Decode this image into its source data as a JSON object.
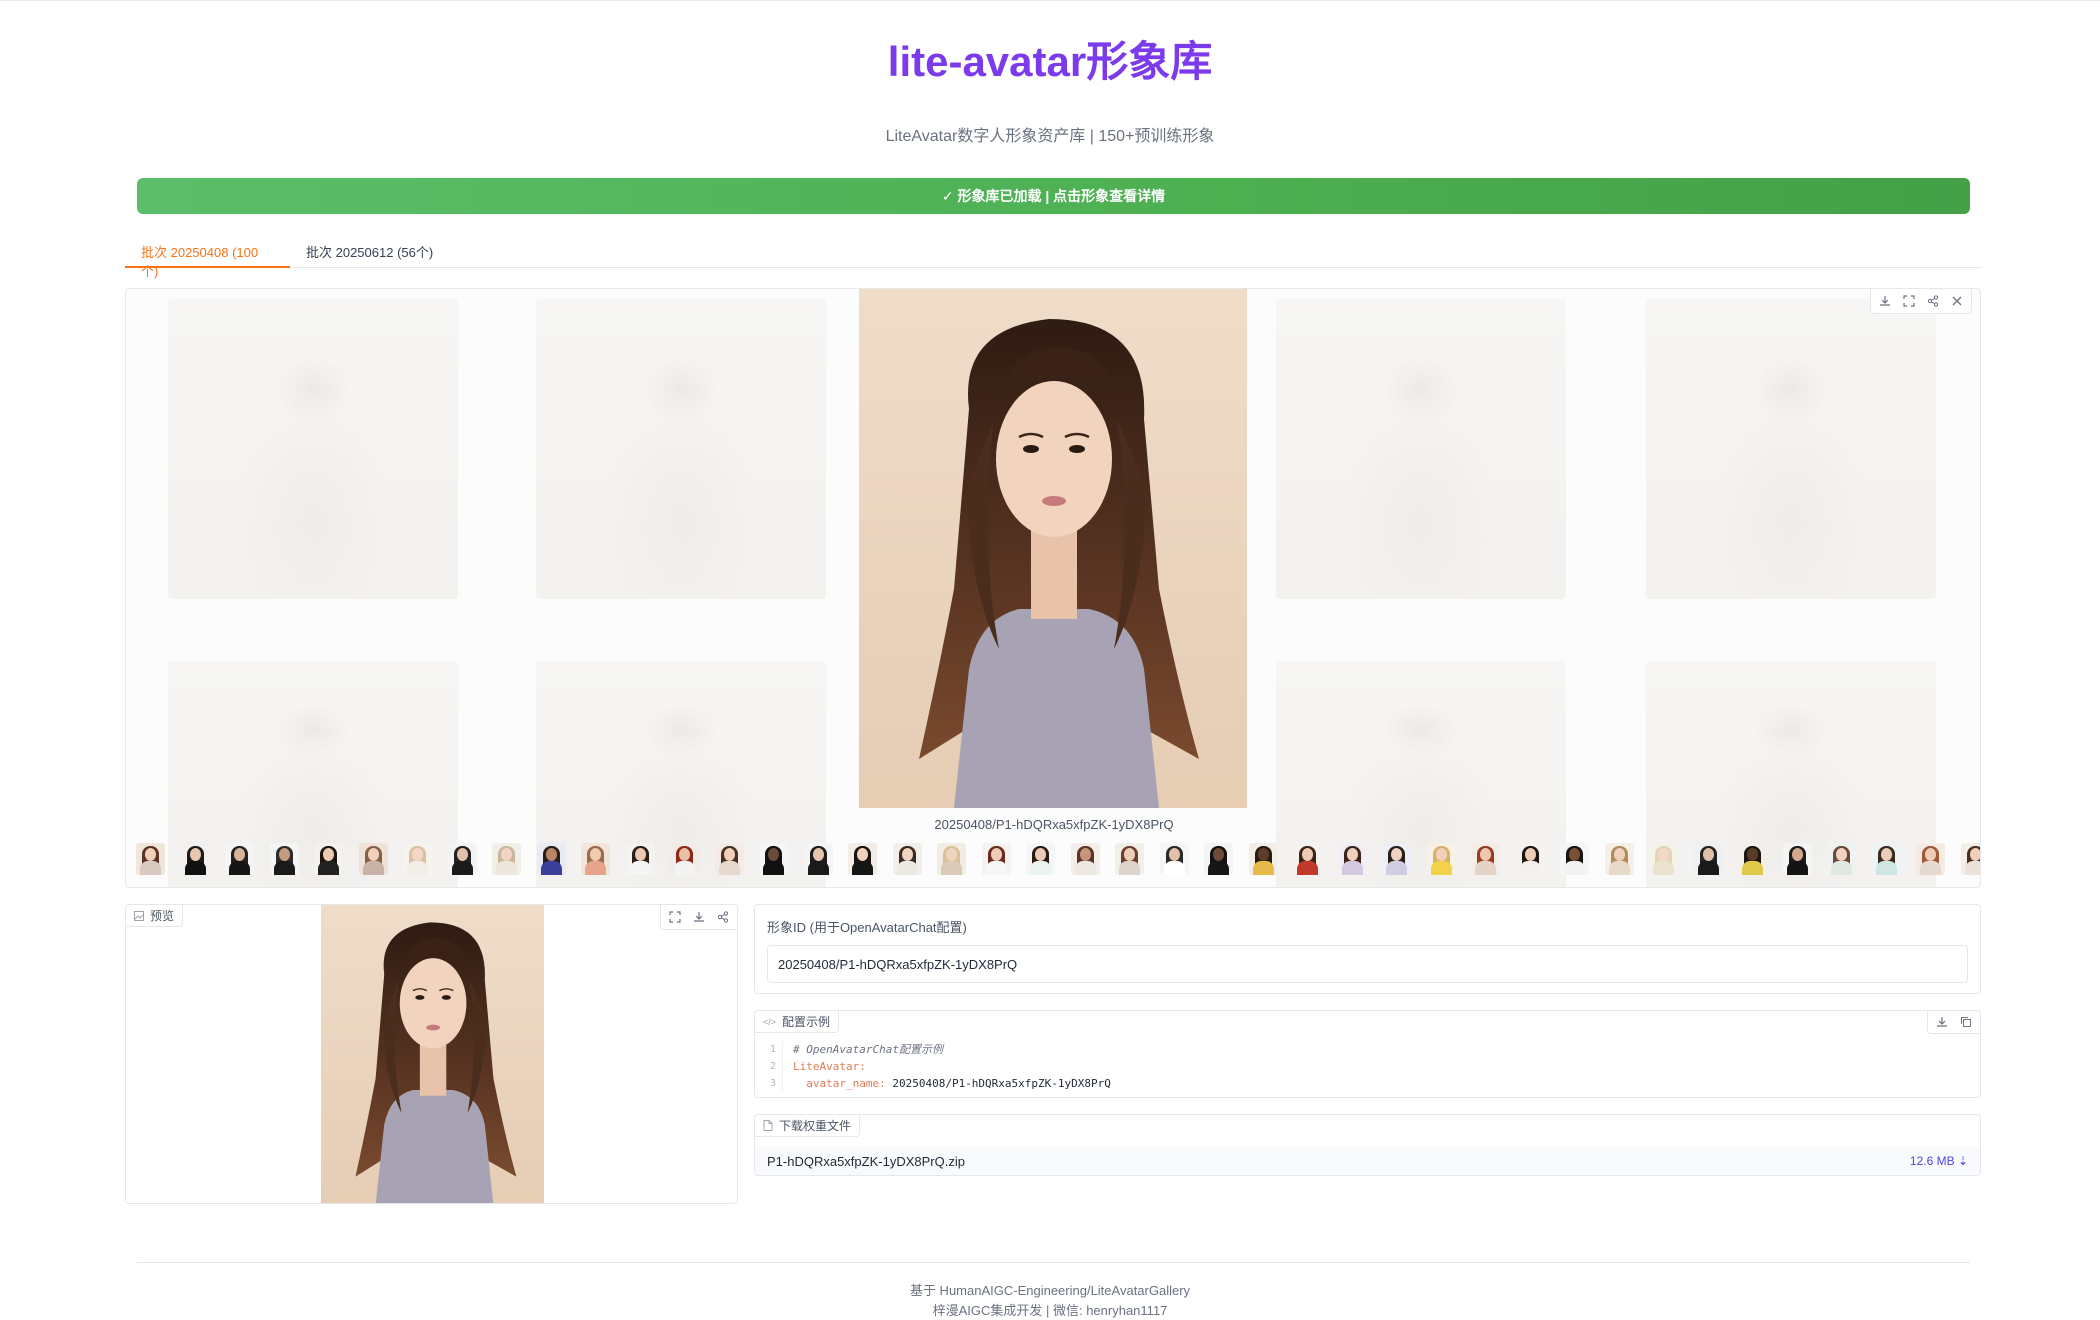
{
  "header": {
    "title": "lite-avatar形象库",
    "subtitle": "LiteAvatar数字人形象资产库 | 150+预训练形象"
  },
  "status": {
    "text": "✓ 形象库已加载 | 点击形象查看详情",
    "color": "#4caf50"
  },
  "tabs": [
    {
      "label": "批次 20250408 (100个)",
      "active": true
    },
    {
      "label": "批次 20250612 (56个)",
      "active": false
    }
  ],
  "gallery": {
    "selected_caption": "20250408/P1-hDQRxa5xfpZK-1yDX8PrQ",
    "tools": [
      "download-icon",
      "fullscreen-icon",
      "share-icon",
      "close-icon"
    ]
  },
  "preview": {
    "label": "预览",
    "tools": [
      "fullscreen-icon",
      "download-icon",
      "share-icon"
    ]
  },
  "avatar_id": {
    "label": "形象ID (用于OpenAvatarChat配置)",
    "value": "20250408/P1-hDQRxa5xfpZK-1yDX8PrQ"
  },
  "config": {
    "label": "配置示例",
    "lines": [
      {
        "num": "1",
        "comment": "# OpenAvatarChat配置示例"
      },
      {
        "num": "2",
        "key": "LiteAvatar:"
      },
      {
        "num": "3",
        "key": "  avatar_name:",
        "value": " 20250408/P1-hDQRxa5xfpZK-1yDX8PrQ"
      }
    ]
  },
  "download": {
    "label": "下载权重文件",
    "file_name": "P1-hDQRxa5xfpZK-1yDX8PrQ.zip",
    "file_size": "12.6 MB ⇣"
  },
  "footer": {
    "line1": "基于 HumanAIGC-Engineering/LiteAvatarGallery",
    "line2": "梓漫AIGC集成开发 | 微信: henryhan1117"
  },
  "colors": {
    "accent": "#7c3aed",
    "tab_active": "#f97316",
    "link": "#4f46e5"
  }
}
